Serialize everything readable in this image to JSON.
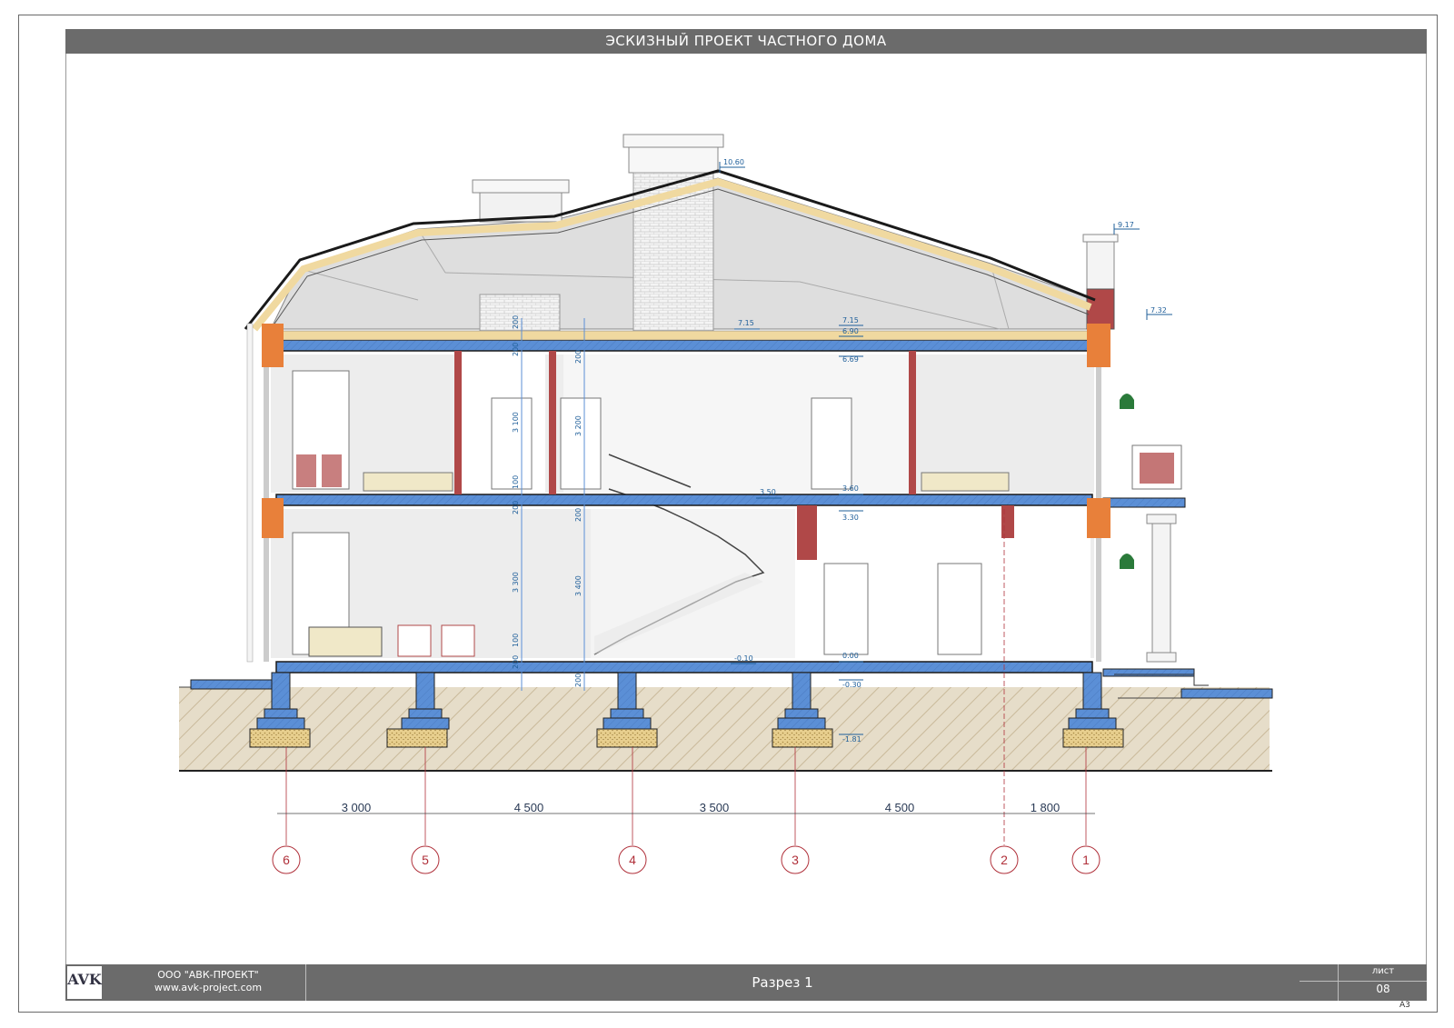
{
  "title": "ЭСКИЗНЫЙ ПРОЕКТ ЧАСТНОГО ДОМА",
  "stamp": {
    "logo": "AVK",
    "company": "ООО \"АВК-ПРОЕКТ\"",
    "website": "www.avk-project.com",
    "sheet_name": "Разрез 1",
    "sheet_label": "лист",
    "sheet_number": "08",
    "format": "А3"
  },
  "elevations": {
    "ridge": "10.60",
    "chimney": "9.17",
    "cornice": "7.32",
    "attic_left": "7.15",
    "attic_right": "7.15",
    "attic_slab": "6.90",
    "ceiling_2": "6.69",
    "floor_2_left": "3.50",
    "floor_2_right": "3.60",
    "ceiling_1": "3.30",
    "floor_1_right": "0.00",
    "floor_1_left": "-0.10",
    "ground": "-0.30",
    "footing": "-1.81"
  },
  "vertical_dims": {
    "left": [
      "200",
      "3 300",
      "200",
      "3 100",
      "200"
    ],
    "left_extra": [
      "100",
      "100",
      "200"
    ],
    "right": [
      "200",
      "3 400",
      "200",
      "3 200",
      "200"
    ]
  },
  "axes": {
    "labels": [
      "6",
      "5",
      "4",
      "3",
      "2",
      "1"
    ],
    "spans": [
      "3 000",
      "4 500",
      "3 500",
      "4 500",
      "1 800"
    ]
  },
  "colors": {
    "concrete": "#5b8fd6",
    "brick": "#e8803a",
    "insulation": "#f0d9a0",
    "masonry": "#b04848",
    "soil": "#d8cdb6",
    "title_bar": "#6b6b6b",
    "axis_marker": "#b0303a",
    "dimension": "#1f5f9a"
  }
}
